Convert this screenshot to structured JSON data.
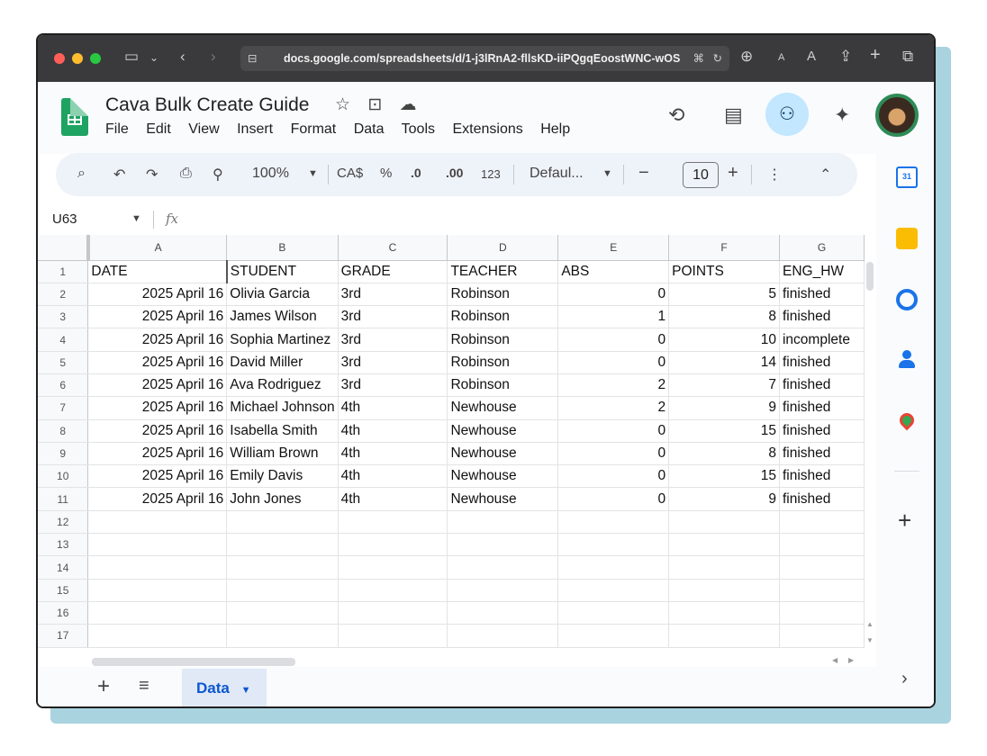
{
  "browser": {
    "url": "docs.google.com/spreadsheets/d/1-j3lRnA2-fllsKD-iiPQgqEoostWNC-wOS",
    "icons": [
      "sidebar-icon",
      "back-icon",
      "forward-icon",
      "site-settings-icon",
      "translate-icon",
      "reload-icon",
      "download-icon",
      "text-smaller-icon",
      "text-larger-icon",
      "share-icon",
      "new-tab-icon",
      "tabs-overview-icon"
    ]
  },
  "app": {
    "title": "Cava Bulk Create Guide",
    "menu": [
      "File",
      "Edit",
      "View",
      "Insert",
      "Format",
      "Data",
      "Tools",
      "Extensions",
      "Help"
    ]
  },
  "toolbar": {
    "zoom": "100%",
    "currency": "CA$",
    "percent": "%",
    "decimal_decrease": ".0",
    "decimal_increase": ".00",
    "number_format": "123",
    "font": "Defaul...",
    "font_size": "10",
    "minus": "−",
    "plus": "+"
  },
  "formula_bar": {
    "cell_ref": "U63",
    "fx": "fx"
  },
  "grid": {
    "columns": [
      "A",
      "B",
      "C",
      "D",
      "E",
      "F",
      "G"
    ],
    "row_numbers": [
      "1",
      "2",
      "3",
      "4",
      "5",
      "6",
      "7",
      "8",
      "9",
      "10",
      "11",
      "12",
      "13",
      "14",
      "15",
      "16",
      "17"
    ],
    "rows": [
      [
        "DATE",
        "STUDENT",
        "GRADE",
        "TEACHER",
        "ABS",
        "POINTS",
        "ENG_HW"
      ],
      [
        "2025 April 16",
        "Olivia Garcia",
        "3rd",
        "Robinson",
        "0",
        "5",
        "finished"
      ],
      [
        "2025 April 16",
        "James Wilson",
        "3rd",
        "Robinson",
        "1",
        "8",
        "finished"
      ],
      [
        "2025 April 16",
        "Sophia Martinez",
        "3rd",
        "Robinson",
        "0",
        "10",
        "incomplete"
      ],
      [
        "2025 April 16",
        "David Miller",
        "3rd",
        "Robinson",
        "0",
        "14",
        "finished"
      ],
      [
        "2025 April 16",
        "Ava Rodriguez",
        "3rd",
        "Robinson",
        "2",
        "7",
        "finished"
      ],
      [
        "2025 April 16",
        "Michael Johnson",
        "4th",
        "Newhouse",
        "2",
        "9",
        "finished"
      ],
      [
        "2025 April 16",
        "Isabella Smith",
        "4th",
        "Newhouse",
        "0",
        "15",
        "finished"
      ],
      [
        "2025 April 16",
        "William Brown",
        "4th",
        "Newhouse",
        "0",
        "8",
        "finished"
      ],
      [
        "2025 April 16",
        "Emily Davis",
        "4th",
        "Newhouse",
        "0",
        "15",
        "finished"
      ],
      [
        "2025 April 16",
        "John Jones",
        "4th",
        "Newhouse",
        "0",
        "9",
        "finished"
      ]
    ]
  },
  "sheet_tabs": {
    "active": "Data"
  },
  "colors": {
    "sheets_green": "#1ea362",
    "share_bg": "#c2e7ff",
    "tab_active_bg": "#e1e9f7",
    "tab_active_text": "#0b57d0"
  }
}
